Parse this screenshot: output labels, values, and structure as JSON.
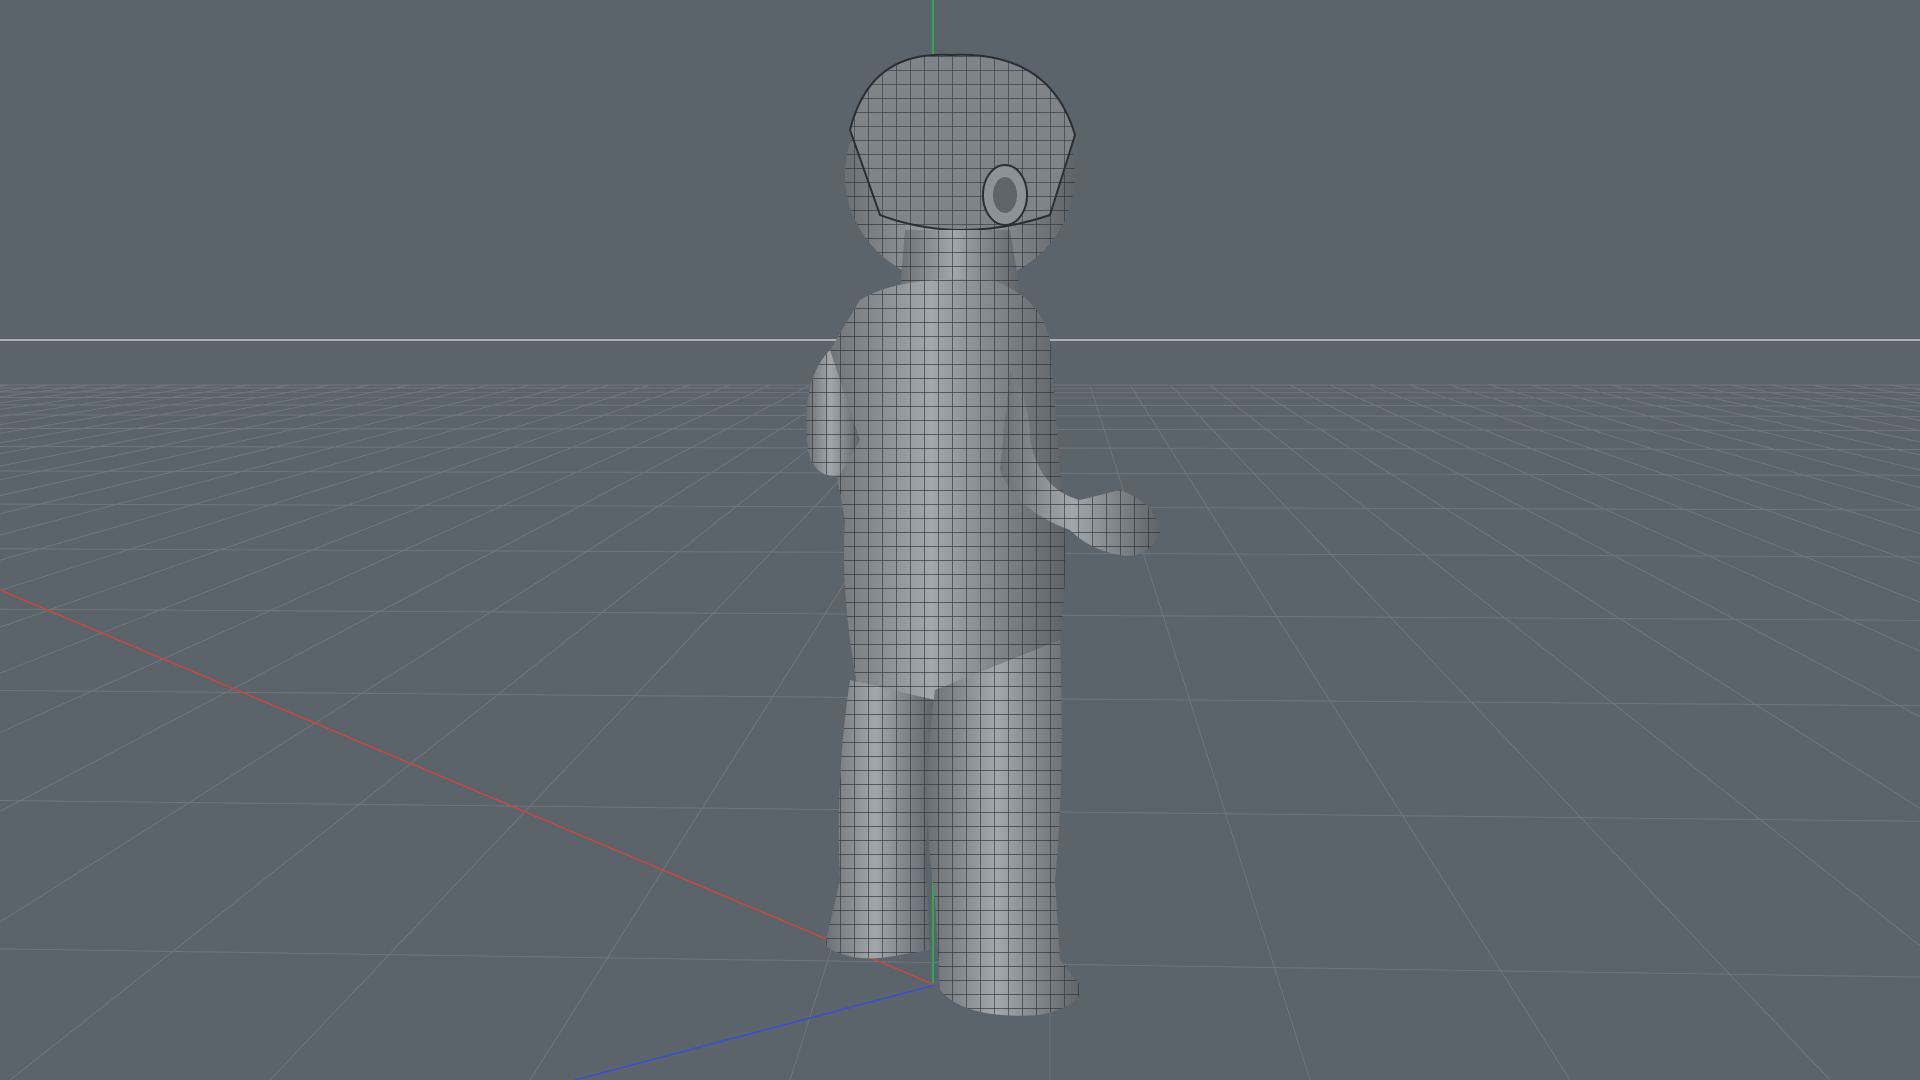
{
  "viewport": {
    "background_color": "#5b636b",
    "grid_color": "#6f767d",
    "horizon_color": "#c9cdd1",
    "axis_colors": {
      "x": "#c24a3e",
      "y": "#2fa84f",
      "z": "#3b4fc8"
    },
    "model": {
      "name": "child",
      "render_mode": "wireframe-on-shaded",
      "shade_color": "#8a8f94",
      "wire_color": "#2b2f33"
    }
  }
}
